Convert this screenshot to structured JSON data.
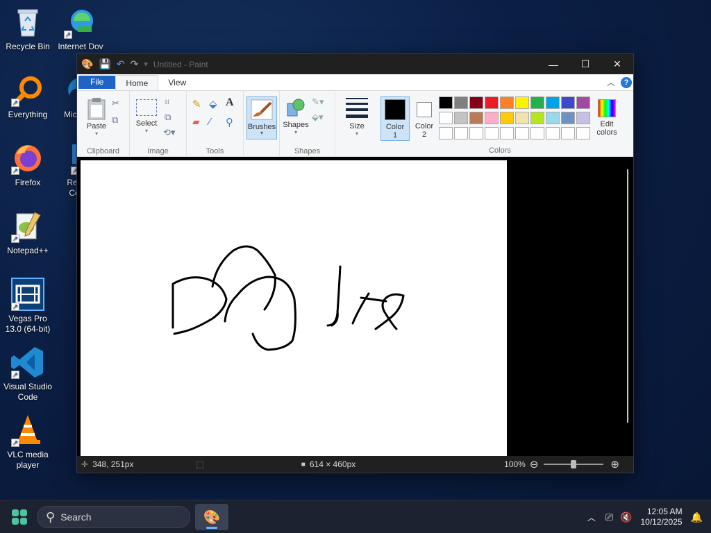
{
  "desktop": {
    "icons": [
      {
        "label": "Recycle Bin"
      },
      {
        "label": "Internet Dov"
      },
      {
        "label": "Everything"
      },
      {
        "label": "Mic E"
      },
      {
        "label": "Firefox"
      },
      {
        "label": "Rec Co"
      },
      {
        "label": "Notepad++"
      },
      {
        "label": "Vegas Pro 13.0 (64-bit)"
      },
      {
        "label": "Visual Studio Code"
      },
      {
        "label": "VLC media player"
      }
    ]
  },
  "window": {
    "title": "Untitled - Paint",
    "controls": {
      "minimize": "—",
      "maximize": "☐",
      "close": "✕"
    }
  },
  "menu": {
    "file": "File",
    "home": "Home",
    "view": "View"
  },
  "ribbon": {
    "clipboard": {
      "paste": "Paste",
      "group": "Clipboard"
    },
    "image": {
      "select": "Select",
      "group": "Image"
    },
    "tools": {
      "group": "Tools"
    },
    "brushes": {
      "label": "Brushes"
    },
    "shapes": {
      "label": "Shapes",
      "group": "Shapes"
    },
    "size": {
      "label": "Size"
    },
    "color1": {
      "line1": "Color",
      "line2": "1",
      "value": "#000000"
    },
    "color2": {
      "line1": "Color",
      "line2": "2",
      "value": "#ffffff"
    },
    "colors": {
      "group": "Colors",
      "edit_line1": "Edit",
      "edit_line2": "colors"
    },
    "palette_row1": [
      "#000000",
      "#7f7f7f",
      "#880015",
      "#ed1c24",
      "#ff7f27",
      "#fff200",
      "#22b14c",
      "#00a2e8",
      "#3f48cc",
      "#a349a4"
    ],
    "palette_row2": [
      "#ffffff",
      "#c3c3c3",
      "#b97a57",
      "#ffaec9",
      "#ffc90e",
      "#efe4b0",
      "#b5e61d",
      "#99d9ea",
      "#7092be",
      "#c8bfe7"
    ],
    "palette_row3": [
      "#ffffff",
      "#ffffff",
      "#ffffff",
      "#ffffff",
      "#ffffff",
      "#ffffff",
      "#ffffff",
      "#ffffff",
      "#ffffff",
      "#ffffff"
    ]
  },
  "status": {
    "cursor_pos": "348, 251px",
    "canvas_size": "614 × 460px",
    "zoom": "100%"
  },
  "taskbar": {
    "search_label": "Search",
    "time": "12:05 AM",
    "date": "10/12/2025"
  }
}
